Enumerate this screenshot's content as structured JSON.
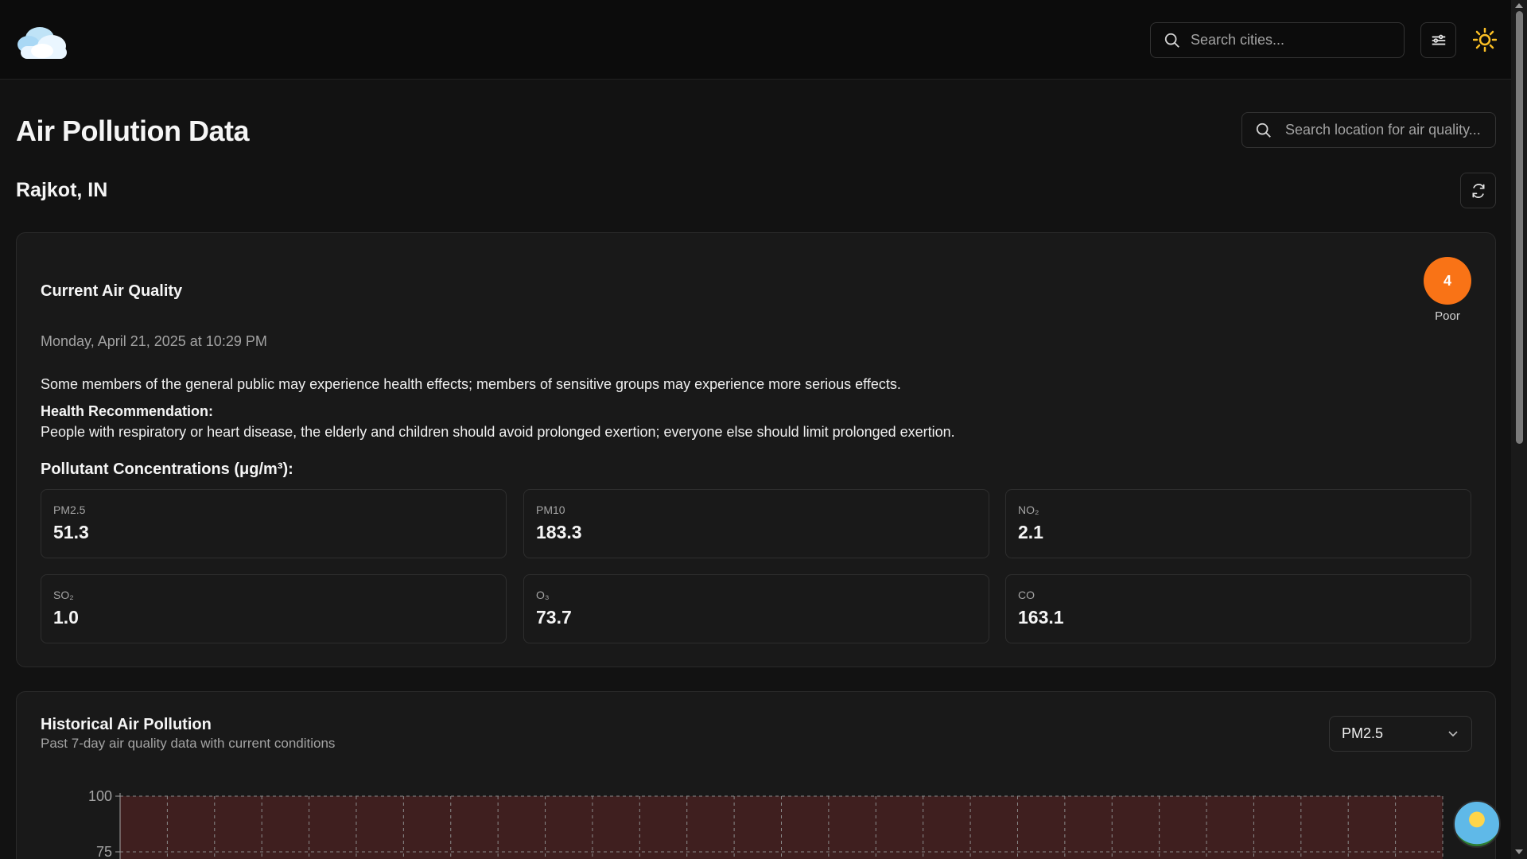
{
  "header": {
    "search_placeholder": "Search cities..."
  },
  "page": {
    "title": "Air Pollution Data",
    "search_placeholder": "Search location for air quality...",
    "location": "Rajkot, IN"
  },
  "current": {
    "title": "Current Air Quality",
    "date": "Monday, April 21, 2025 at 10:29 PM",
    "aqi_value": "4",
    "aqi_label": "Poor",
    "aqi_color": "#f97316",
    "effects": "Some members of the general public may experience health effects; members of sensitive groups may experience more serious effects.",
    "recommendation_title": "Health Recommendation:",
    "recommendation_text": "People with respiratory or heart disease, the elderly and children should avoid prolonged exertion; everyone else should limit prolonged exertion.",
    "concentrations_title": "Pollutant Concentrations (μg/m³):",
    "pollutants": [
      {
        "name": "PM2.5",
        "value": "51.3"
      },
      {
        "name": "PM10",
        "value": "183.3"
      },
      {
        "name": "NO₂",
        "value": "2.1"
      },
      {
        "name": "SO₂",
        "value": "1.0"
      },
      {
        "name": "O₃",
        "value": "73.7"
      },
      {
        "name": "CO",
        "value": "163.1"
      }
    ]
  },
  "historical": {
    "title": "Historical Air Pollution",
    "subtitle": "Past 7-day air quality data with current conditions",
    "selected_pollutant": "PM2.5"
  },
  "chart_data": {
    "type": "area",
    "ytick_labels": [
      "100",
      "75"
    ],
    "grid": true,
    "band_color": "#3f1f1f"
  }
}
